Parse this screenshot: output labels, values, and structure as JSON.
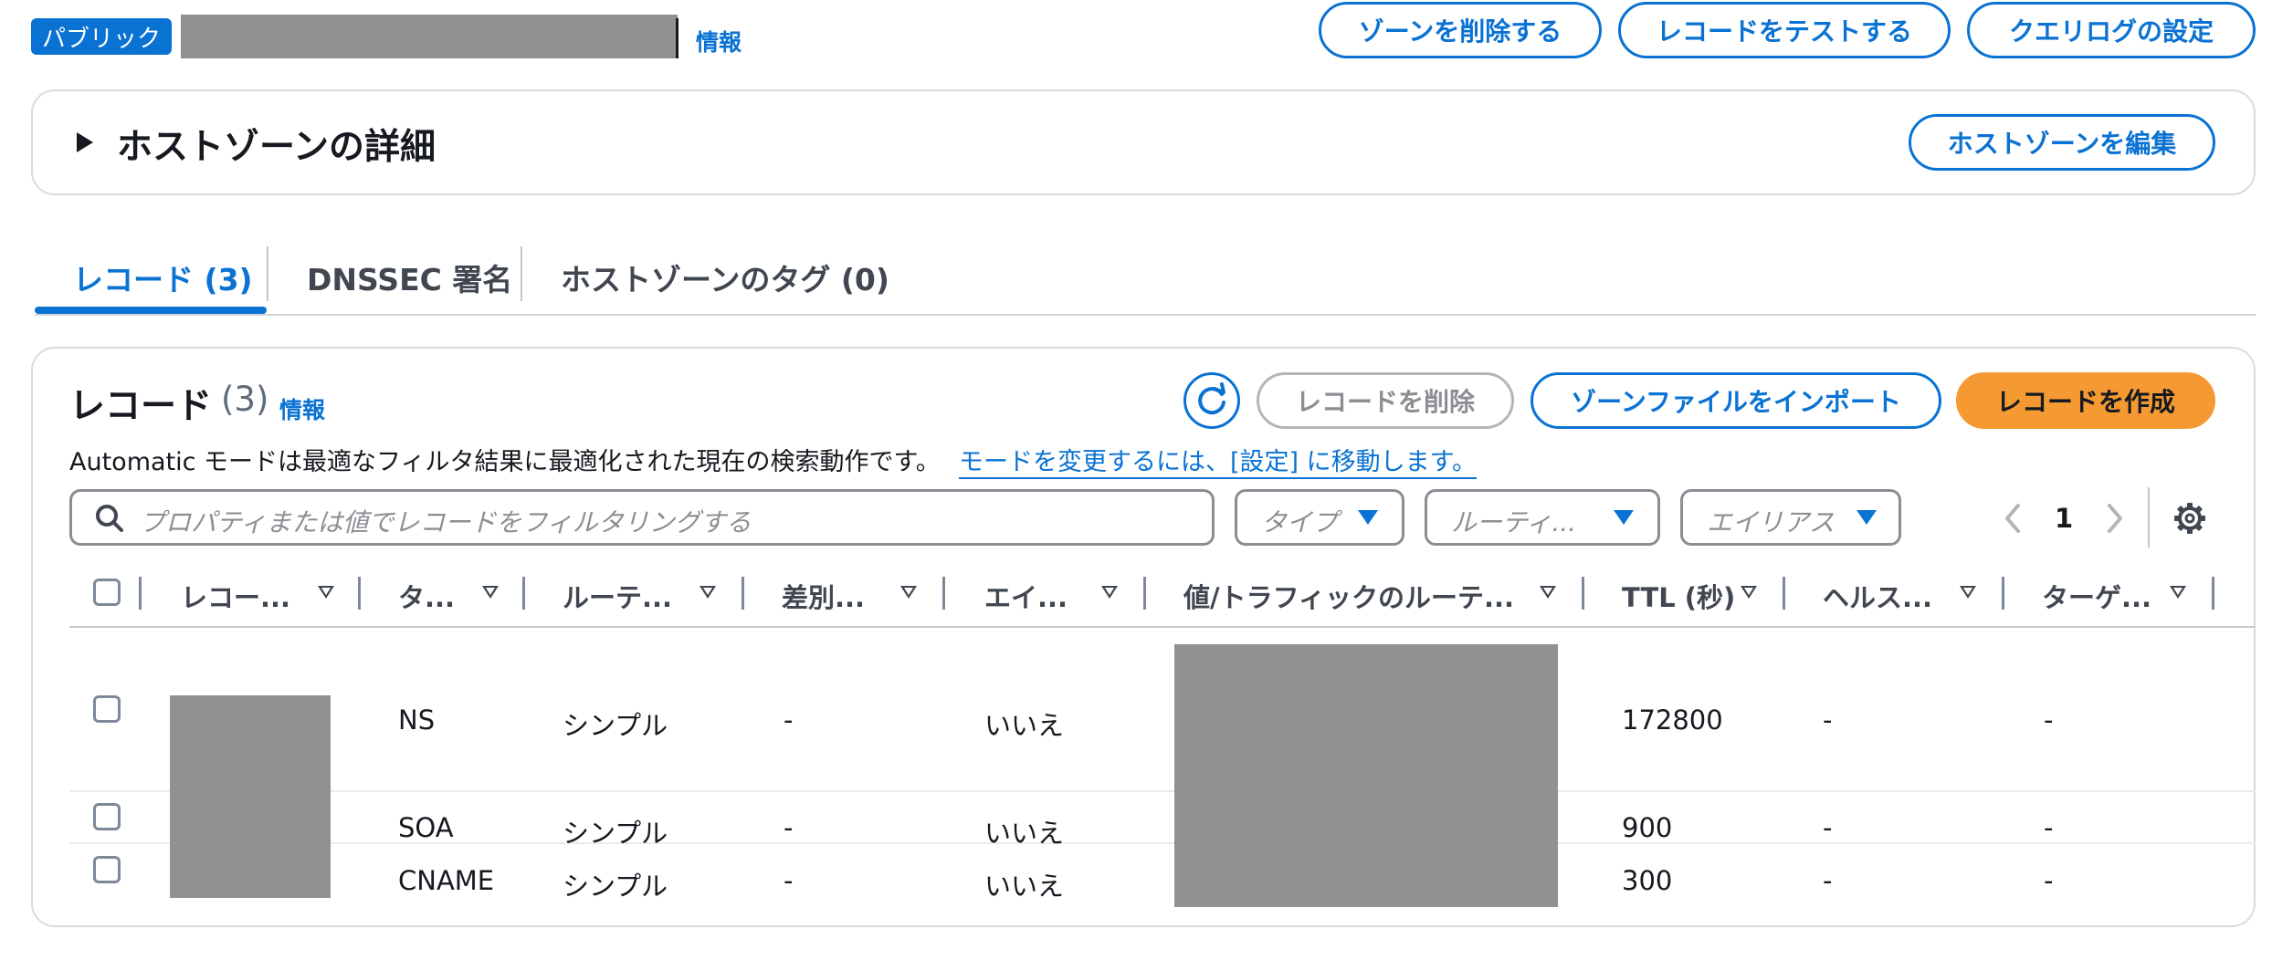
{
  "header": {
    "badge": "パブリック",
    "info": "情報",
    "buttons": {
      "delete_zone": "ゾーンを削除する",
      "test_record": "レコードをテストする",
      "query_log": "クエリログの設定"
    }
  },
  "details_panel": {
    "title": "ホストゾーンの詳細",
    "edit_button": "ホストゾーンを編集"
  },
  "tabs": [
    {
      "label": "レコード (3)",
      "active": true
    },
    {
      "label": "DNSSEC 署名",
      "active": false
    },
    {
      "label": "ホストゾーンのタグ (0)",
      "active": false
    }
  ],
  "records": {
    "title": "レコード",
    "count": "(3)",
    "info": "情報",
    "mode_text": "Automatic モードは最適なフィルタ結果に最適化された現在の検索動作です。",
    "mode_link": "モードを変更するには、[設定] に移動します。",
    "buttons": {
      "delete": "レコードを削除",
      "import": "ゾーンファイルをインポート",
      "create": "レコードを作成"
    },
    "search_placeholder": "プロパティまたは値でレコードをフィルタリングする",
    "filters": {
      "type": "タイプ",
      "routing": "ルーティ...",
      "alias": "エイリアス"
    },
    "page": "1",
    "columns": [
      "レコー...",
      "タ...",
      "ルーテ...",
      "差別...",
      "エイ...",
      "値/トラフィックのルーテ...",
      "TTL (秒)",
      "ヘルス...",
      "ターゲ..."
    ],
    "rows": [
      {
        "type": "NS",
        "routing": "シンプル",
        "diff": "-",
        "alias": "いいえ",
        "ttl": "172800",
        "health": "-",
        "target": "-"
      },
      {
        "type": "SOA",
        "routing": "シンプル",
        "diff": "-",
        "alias": "いいえ",
        "ttl": "900",
        "health": "-",
        "target": "-"
      },
      {
        "type": "CNAME",
        "routing": "シンプル",
        "diff": "-",
        "alias": "いいえ",
        "ttl": "300",
        "health": "-",
        "target": "-"
      }
    ]
  },
  "colors": {
    "accent": "#0972d3",
    "primary_button": "#f59a32",
    "redaction": "#919191"
  }
}
